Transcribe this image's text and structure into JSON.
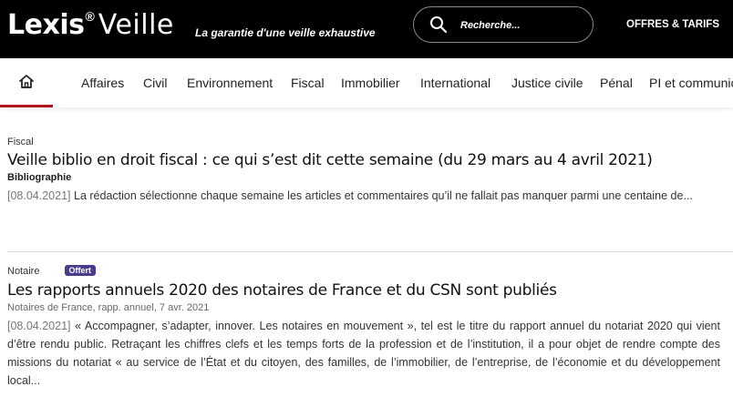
{
  "header": {
    "logo_brand": "Lexis",
    "logo_registered": "®",
    "logo_product": "Veille",
    "tagline": "La garantie d'une veille exhaustive",
    "search_placeholder": "Recherche...",
    "offers_label": "OFFRES & TARIFS"
  },
  "nav": {
    "home_icon": "home-icon",
    "items": [
      "Affaires",
      "Civil",
      "Environnement",
      "Fiscal",
      "Immobilier",
      "International",
      "Justice civile",
      "Pénal",
      "PI et communic"
    ]
  },
  "articles": [
    {
      "category": "Fiscal",
      "title": "Veille biblio en droit fiscal : ce qui s’est dit cette semaine (du 29 mars au 4 avril 2021)",
      "type": "Bibliographie",
      "date": "[08.04.2021]",
      "summary": "La rédaction sélectionne chaque semaine les articles et commentaires qu’il ne fallait pas manquer parmi une centaine de..."
    },
    {
      "category": "Notaire",
      "badge": "Offert",
      "title": "Les rapports annuels 2020 des notaires de France et du CSN sont publiés",
      "source": "Notaires de France, rapp. annuel, 7 avr. 2021",
      "date": "[08.04.2021]",
      "summary": "« Accompagner, s’adapter, innover. Les notaires en mouvement », tel est le titre du rapport annuel du notariat 2020 qui vient d’être rendu public. Retraçant les chiffres clefs et les temps forts de la profession et de l’institution, il a pour objet de rendre compte des missions du notariat « au service de l’État et du citoyen, des familles, de l’immobilier, de l’entreprise, de l’économie et du développement local..."
    }
  ],
  "colors": {
    "header_bg": "#000000",
    "active_tab_underline": "#b3131a",
    "badge_bg": "#4b3b8f"
  }
}
